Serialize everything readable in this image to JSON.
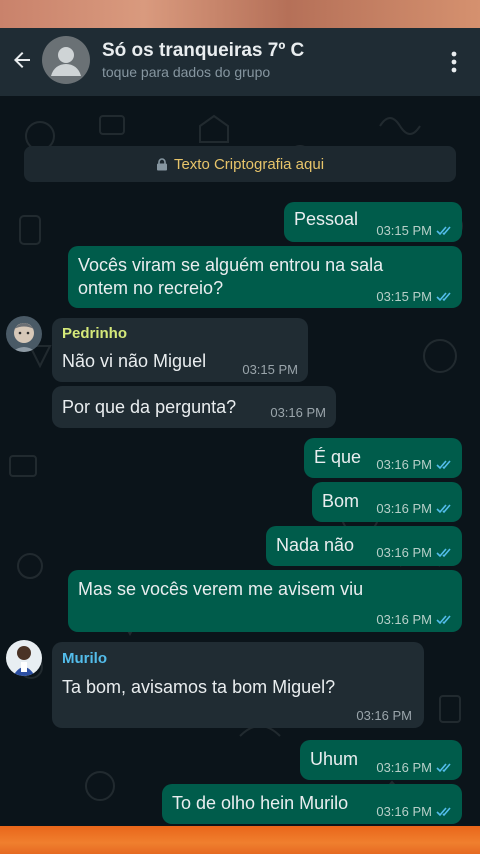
{
  "header": {
    "title": "Só os tranqueiras 7º C",
    "subtitle": "toque para dados do grupo"
  },
  "encryption_notice": "Texto Criptografia aqui",
  "messages": [
    {
      "dir": "out",
      "text": "Pessoal",
      "time": "03:15 PM"
    },
    {
      "dir": "out",
      "text_lines": [
        "Vocês viram se alguém entrou na sala",
        "ontem no recreio?"
      ],
      "time": "03:15 PM"
    },
    {
      "dir": "in",
      "sender": "Pedrinho",
      "text": "Não vi não Miguel",
      "time": "03:15 PM"
    },
    {
      "dir": "in",
      "text": "Por que da pergunta?",
      "time": "03:16 PM"
    },
    {
      "dir": "out",
      "text": "É que",
      "time": "03:16 PM"
    },
    {
      "dir": "out",
      "text": "Bom",
      "time": "03:16 PM"
    },
    {
      "dir": "out",
      "text": "Nada não",
      "time": "03:16 PM"
    },
    {
      "dir": "out",
      "text": "Mas se vocês verem me avisem viu",
      "time": "03:16 PM"
    },
    {
      "dir": "in",
      "sender": "Murilo",
      "text": "Ta bom, avisamos ta bom Miguel?",
      "time": "03:16 PM"
    },
    {
      "dir": "out",
      "text": "Uhum",
      "time": "03:16 PM"
    },
    {
      "dir": "out",
      "text": "To de olho hein Murilo",
      "time": "03:16 PM"
    }
  ],
  "colors": {
    "outgoing_bubble": "#005c4b",
    "incoming_bubble": "#202c33",
    "pedrinho_name": "#d5e97a",
    "murilo_name": "#53bdeb",
    "read_ticks": "#53bdeb"
  },
  "icons": {
    "back": "arrow-left-icon",
    "avatar": "group-avatar-icon",
    "menu": "more-vertical-icon",
    "lock": "lock-icon",
    "read": "double-check-icon"
  }
}
